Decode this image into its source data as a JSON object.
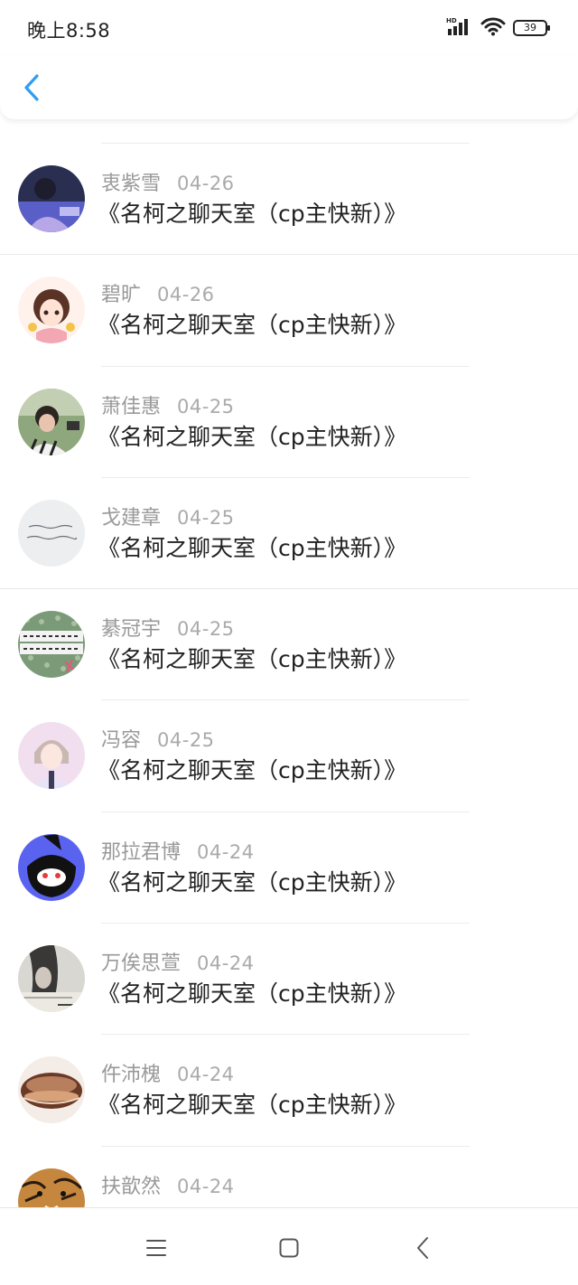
{
  "status_bar": {
    "time": "晚上8:58",
    "network": "HD",
    "battery": "39"
  },
  "header": {
    "back_icon": "chevron-left-icon",
    "accent": "#2e9df4"
  },
  "list": {
    "items": [
      {
        "author": "衷紫雪",
        "date": "04-26",
        "title": "《名柯之聊天室（cp主快新）》"
      },
      {
        "author": "碧旷",
        "date": "04-26",
        "title": "《名柯之聊天室（cp主快新）》"
      },
      {
        "author": "萧佳惠",
        "date": "04-25",
        "title": "《名柯之聊天室（cp主快新）》"
      },
      {
        "author": "戈建章",
        "date": "04-25",
        "title": "《名柯之聊天室（cp主快新）》"
      },
      {
        "author": "綦冠宇",
        "date": "04-25",
        "title": "《名柯之聊天室（cp主快新）》"
      },
      {
        "author": "冯容",
        "date": "04-25",
        "title": "《名柯之聊天室（cp主快新）》"
      },
      {
        "author": "那拉君博",
        "date": "04-24",
        "title": "《名柯之聊天室（cp主快新）》"
      },
      {
        "author": "万俟思萱",
        "date": "04-24",
        "title": "《名柯之聊天室（cp主快新）》"
      },
      {
        "author": "仵沛槐",
        "date": "04-24",
        "title": "《名柯之聊天室（cp主快新）》"
      },
      {
        "author": "扶歆然",
        "date": "04-24",
        "title": ""
      }
    ]
  },
  "nav_bar": {
    "menu_icon": "menu-icon",
    "home_icon": "home-square-icon",
    "back_icon": "back-triangle-icon"
  }
}
